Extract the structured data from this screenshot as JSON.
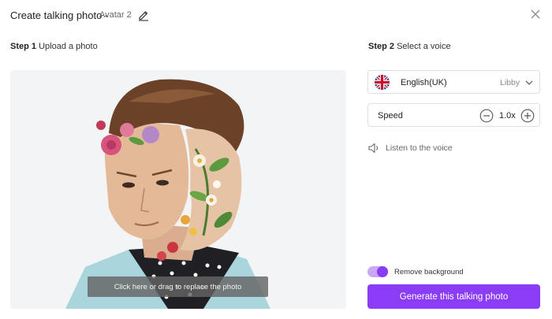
{
  "header": {
    "title": "Create talking photo -",
    "avatar_name": "Avatar 2",
    "icons": {
      "edit": "pencil-icon",
      "close": "close-icon"
    }
  },
  "step1": {
    "label_bold": "Step 1",
    "label_text": "Upload a photo"
  },
  "upload": {
    "replace_text": "Click here or drag to replace the photo"
  },
  "step2": {
    "label_bold": "Step 2",
    "label_text": "Select a voice"
  },
  "voice": {
    "language": "English(UK)",
    "voice_name": "Libby",
    "flag_icon": "uk-flag-icon",
    "dropdown_icon": "chevron-down-icon"
  },
  "speed": {
    "label": "Speed",
    "value": "1.0x"
  },
  "listen": {
    "label": "Listen to the voice",
    "icon": "speaker-icon"
  },
  "remove_background": {
    "label": "Remove background",
    "enabled": true
  },
  "generate_button": {
    "label": "Generate this talking photo"
  },
  "colors": {
    "accent": "#8b3cf7",
    "toggle_track": "#c9a8f5",
    "replace_bar": "#646464"
  }
}
